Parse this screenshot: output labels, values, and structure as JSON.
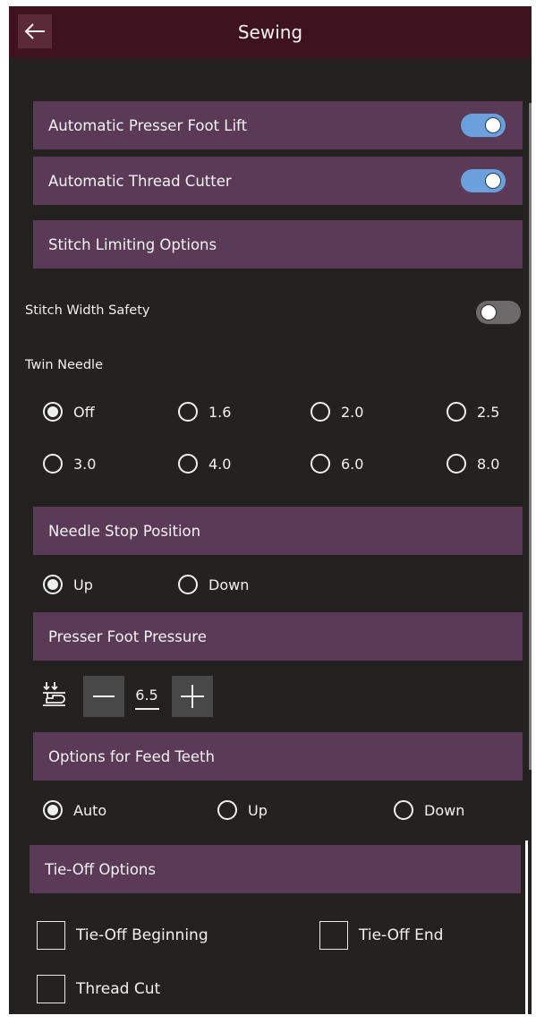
{
  "header": {
    "title": "Sewing",
    "back_icon": "arrow-left-icon"
  },
  "settings": {
    "presser_foot_lift": {
      "label": "Automatic Presser Foot Lift",
      "on": true
    },
    "thread_cutter": {
      "label": "Automatic Thread Cutter",
      "on": true
    },
    "stitch_limiting": {
      "label": "Stitch Limiting Options"
    },
    "stitch_width_safety": {
      "label": "Stitch Width Safety",
      "on": false
    },
    "twin_needle": {
      "label": "Twin Needle",
      "options": [
        "Off",
        "1.6",
        "2.0",
        "2.5",
        "3.0",
        "4.0",
        "6.0",
        "8.0"
      ],
      "selected": "Off"
    },
    "needle_stop": {
      "label": "Needle Stop Position",
      "options": [
        "Up",
        "Down"
      ],
      "selected": "Up"
    },
    "presser_foot_pressure": {
      "label": "Presser Foot Pressure",
      "value": "6.5",
      "icon": "presser-foot-pressure-icon"
    },
    "feed_teeth": {
      "label": "Options for Feed Teeth",
      "options": [
        "Auto",
        "Up",
        "Down"
      ],
      "selected": "Auto"
    },
    "tie_off": {
      "label": "Tie-Off Options",
      "beginning": "Tie-Off Beginning",
      "end": "Tie-Off End",
      "thread_cut": "Thread Cut"
    }
  },
  "colors": {
    "title_bar": "#3f1220",
    "background": "#232220",
    "section_bar": "#5b3a58",
    "toggle_on": "#6aa0dc",
    "toggle_off": "#6c6a6a"
  }
}
